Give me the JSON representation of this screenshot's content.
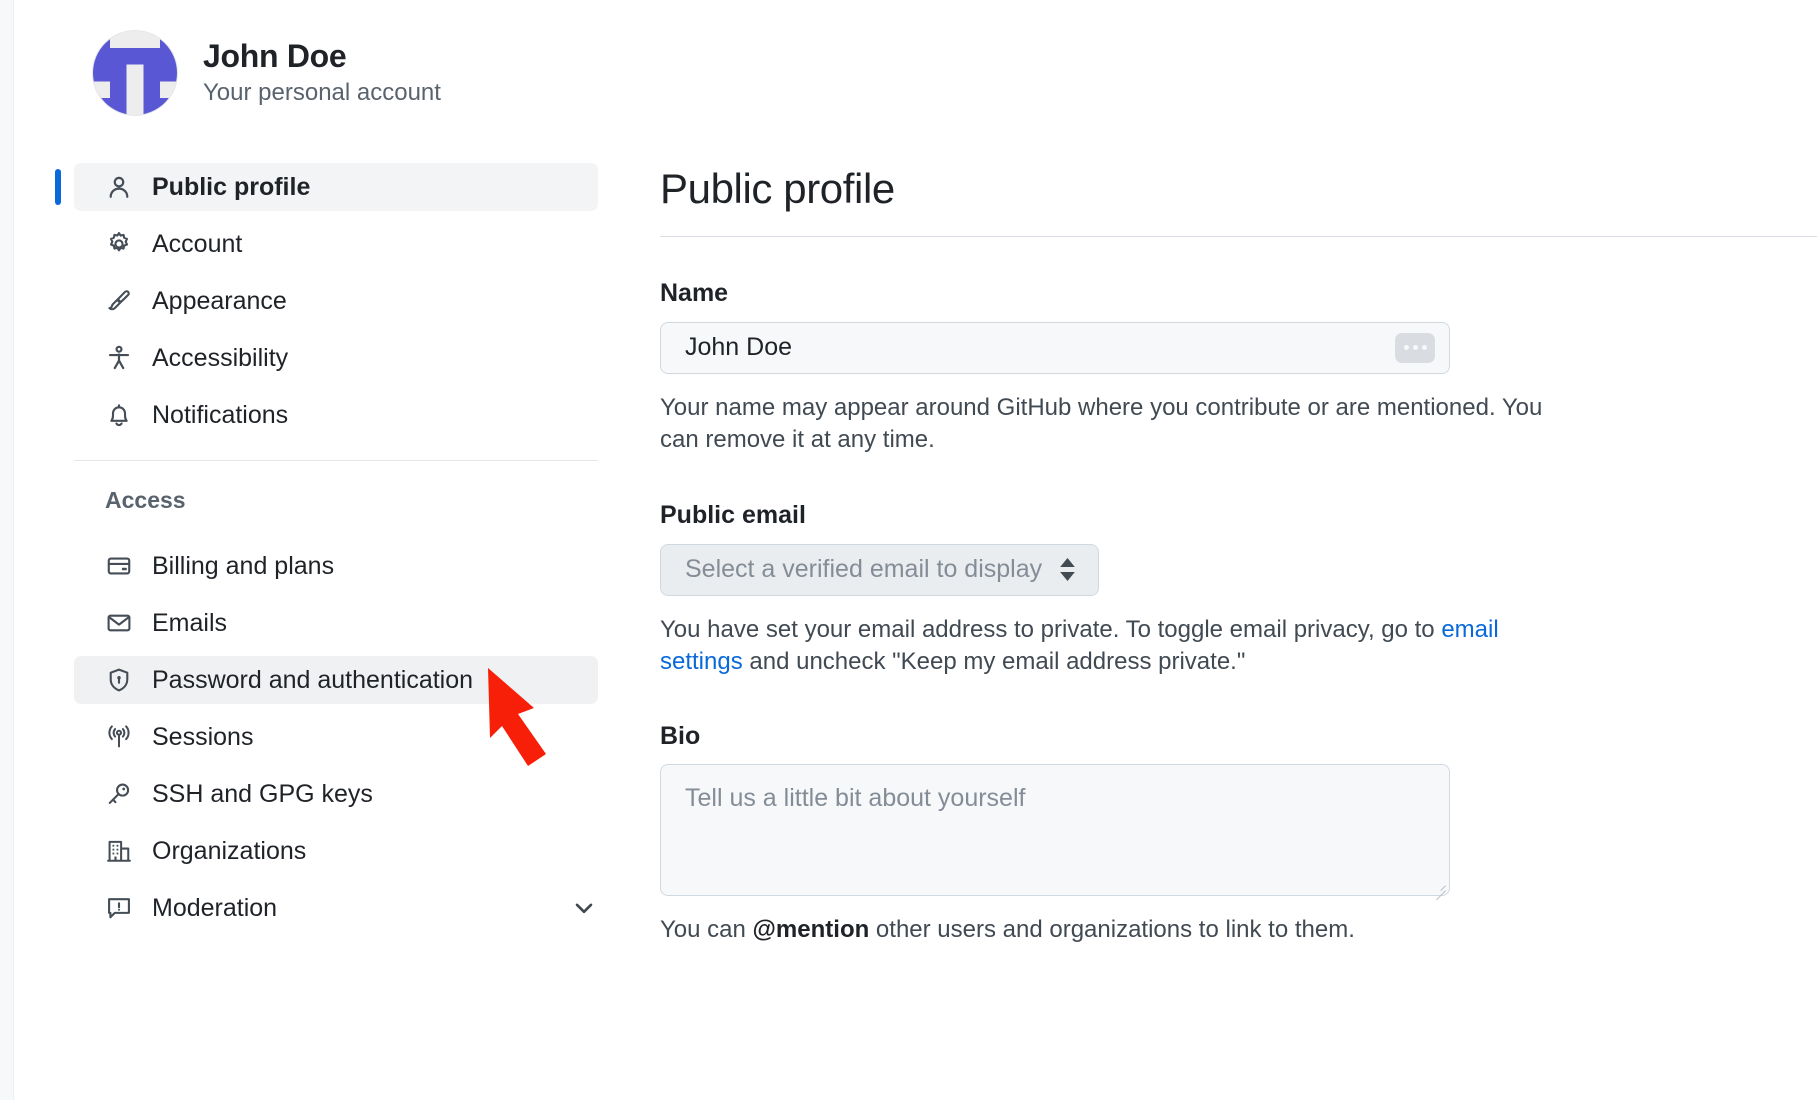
{
  "account": {
    "name": "John Doe",
    "subtitle": "Your personal account",
    "avatar_icon": "identicon-avatar"
  },
  "sidebar": {
    "primary_items": [
      {
        "label": "Public profile",
        "icon": "person-icon",
        "selected": true
      },
      {
        "label": "Account",
        "icon": "gear-icon",
        "selected": false
      },
      {
        "label": "Appearance",
        "icon": "paintbrush-icon",
        "selected": false
      },
      {
        "label": "Accessibility",
        "icon": "accessibility-icon",
        "selected": false
      },
      {
        "label": "Notifications",
        "icon": "bell-icon",
        "selected": false
      }
    ],
    "section_title": "Access",
    "access_items": [
      {
        "label": "Billing and plans",
        "icon": "credit-card-icon",
        "hovered": false
      },
      {
        "label": "Emails",
        "icon": "mail-icon",
        "hovered": false
      },
      {
        "label": "Password and authentication",
        "icon": "shield-lock-icon",
        "hovered": true
      },
      {
        "label": "Sessions",
        "icon": "broadcast-icon",
        "hovered": false
      },
      {
        "label": "SSH and GPG keys",
        "icon": "key-icon",
        "hovered": false
      },
      {
        "label": "Organizations",
        "icon": "organization-icon",
        "hovered": false
      },
      {
        "label": "Moderation",
        "icon": "report-icon",
        "hovered": false,
        "expandable": true
      }
    ]
  },
  "main": {
    "title": "Public profile",
    "name_field": {
      "label": "Name",
      "value": "John Doe",
      "badge_icon": "ellipsis-icon",
      "help": "Your name may appear around GitHub where you contribute or are mentioned. You can remove it at any time."
    },
    "email_field": {
      "label": "Public email",
      "selected_option": "Select a verified email to display",
      "help_prefix": "You have set your email address to private. To toggle email privacy, go to ",
      "help_link": "email settings",
      "help_suffix": " and uncheck \"Keep my email address private.\""
    },
    "bio_field": {
      "label": "Bio",
      "placeholder": "Tell us a little bit about yourself",
      "help_prefix": "You can ",
      "help_bold": "@mention",
      "help_suffix": " other users and organizations to link to them."
    }
  },
  "annotation": {
    "arrow_color": "#f81f09",
    "points_to": "Password and authentication"
  },
  "colors": {
    "accent": "#0969da",
    "selected_bar": "#0969da",
    "identicon": "#5a57d4",
    "link": "#0969da"
  }
}
